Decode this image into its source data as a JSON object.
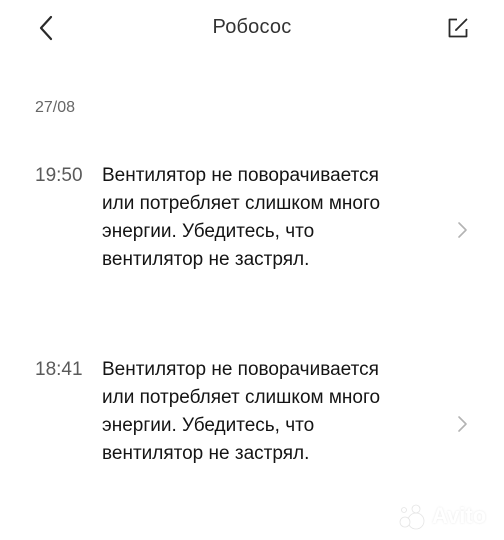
{
  "header": {
    "title": "Робосос",
    "back_icon": "chevron-left-icon",
    "edit_icon": "edit-icon"
  },
  "date_label": "27/08",
  "entries": [
    {
      "time": "19:50",
      "message": "Вентилятор не поворачивается или потребляет слишком много энергии. Убедитесь, что вентилятор не застрял."
    },
    {
      "time": "18:41",
      "message": "Вентилятор не поворачивается или потребляет слишком много энергии. Убедитесь, что вентилятор не застрял."
    }
  ],
  "watermark": {
    "text": "Avito"
  }
}
